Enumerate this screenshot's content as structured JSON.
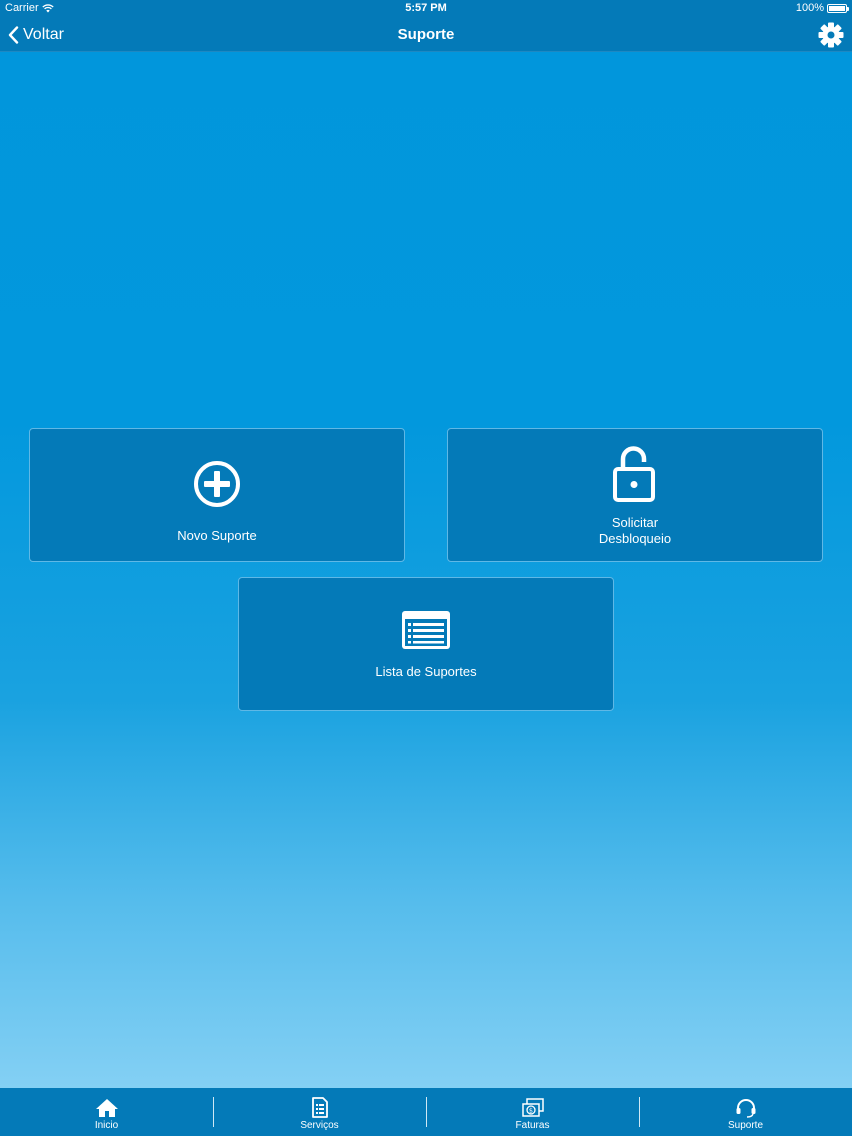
{
  "status_bar": {
    "carrier": "Carrier",
    "time": "5:57 PM",
    "battery": "100%"
  },
  "nav": {
    "back_label": "Voltar",
    "title": "Suporte"
  },
  "tiles": {
    "novo_suporte": "Novo Suporte",
    "solicitar_line1": "Solicitar",
    "solicitar_line2": "Desbloqueio",
    "lista_suportes": "Lista de Suportes"
  },
  "tabs": [
    {
      "label": "Inicio",
      "icon": "home-icon"
    },
    {
      "label": "Serviços",
      "icon": "document-list-icon"
    },
    {
      "label": "Faturas",
      "icon": "money-bills-icon"
    },
    {
      "label": "Suporte",
      "icon": "headset-icon"
    }
  ],
  "colors": {
    "bar": "#047ab8",
    "background_top": "#0196dc",
    "background_bottom": "#84d0f4",
    "tile_border": "#5fb8e6"
  }
}
